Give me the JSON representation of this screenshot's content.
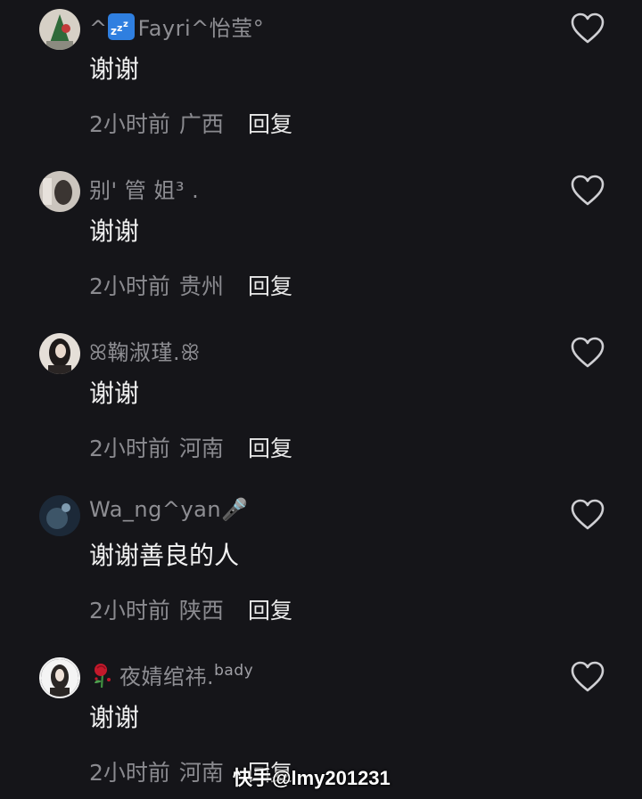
{
  "comments": [
    {
      "username": "^💤Fayri^怡莹°",
      "username_parts": [
        "^",
        "Fayri^怡莹°"
      ],
      "text": "谢谢",
      "time": "2小时前",
      "location": "广西",
      "reply_label": "回复",
      "avatar_colors": [
        "#d9d2c8",
        "#2f6a3a"
      ]
    },
    {
      "username": "别' 管 姐³ .",
      "text": "谢谢",
      "time": "2小时前",
      "location": "贵州",
      "reply_label": "回复",
      "avatar_colors": [
        "#cfc9c2",
        "#3b3532"
      ]
    },
    {
      "username": "ꕤ鞠淑瑾.ꕥ",
      "text": "谢谢",
      "time": "2小时前",
      "location": "河南",
      "reply_label": "回复",
      "avatar_colors": [
        "#e8e2dc",
        "#1f1b1a"
      ]
    },
    {
      "username": "Wa_ng^yan🎤",
      "text": "谢谢善良的人",
      "time": "2小时前",
      "location": "陕西",
      "reply_label": "回复",
      "avatar_colors": [
        "#1e2d3c",
        "#6f8aa0"
      ]
    },
    {
      "username": "🥀夜婧绾祎.bady",
      "username_main": "夜婧绾祎.",
      "username_sup": "bady",
      "text": "谢谢",
      "time": "2小时前",
      "location": "河南",
      "reply_label": "回复",
      "avatar_colors": [
        "#f2f2f2",
        "#2a2624"
      ]
    }
  ],
  "watermark": "快手@lmy201231",
  "icons": {
    "like": "heart-outline-icon",
    "zzz": "zzz-icon",
    "microphone": "microphone-icon",
    "rose": "wilted-rose-icon"
  },
  "colors": {
    "background": "#151519",
    "username": "#8e8e93",
    "text": "#f2f2f2",
    "meta": "#8a8a8f",
    "reply": "#e8e8e8"
  }
}
